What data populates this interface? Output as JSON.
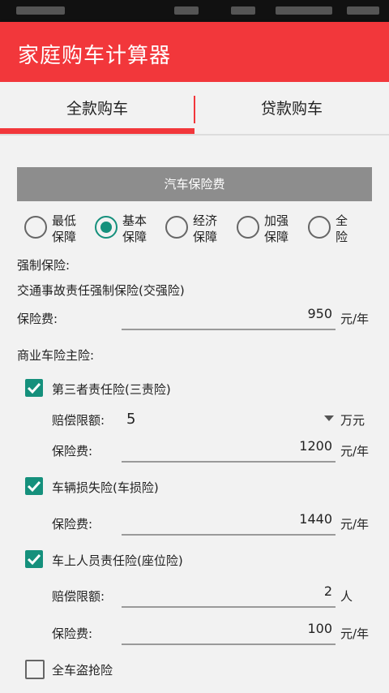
{
  "app": {
    "title": "家庭购车计算器"
  },
  "tabs": [
    {
      "label": "全款购车"
    },
    {
      "label": "贷款购车"
    }
  ],
  "section": {
    "title": "汽车保险费"
  },
  "plans": [
    {
      "label": "最低\n保障",
      "selected": false
    },
    {
      "label": "基本\n保障",
      "selected": true
    },
    {
      "label": "经济\n保障",
      "selected": false
    },
    {
      "label": "加强\n保障",
      "selected": false
    },
    {
      "label": "全\n险",
      "selected": false
    }
  ],
  "compulsory": {
    "heading": "强制保险:",
    "name": "交通事故责任强制保险(交强险)",
    "fee_label": "保险费:",
    "fee_value": "950",
    "unit": "元/年"
  },
  "commercial": {
    "heading": "商业车险主险:",
    "third_party": {
      "label": "第三者责任险(三责险)",
      "checked": true,
      "limit_label": "赔偿限额:",
      "limit_value": "5",
      "limit_unit": "万元",
      "fee_label": "保险费:",
      "fee_value": "1200",
      "fee_unit": "元/年"
    },
    "vehicle_loss": {
      "label": "车辆损失险(车损险)",
      "checked": true,
      "fee_label": "保险费:",
      "fee_value": "1440",
      "fee_unit": "元/年"
    },
    "passenger": {
      "label": "车上人员责任险(座位险)",
      "checked": true,
      "limit_label": "赔偿限额:",
      "limit_value": "2",
      "limit_unit": "人",
      "fee_label": "保险费:",
      "fee_value": "100",
      "fee_unit": "元/年"
    },
    "theft": {
      "label": "全车盗抢险",
      "checked": false
    }
  },
  "colors": {
    "primary": "#f2373b",
    "accent": "#15907c",
    "section_bg": "#8d8d8d"
  }
}
